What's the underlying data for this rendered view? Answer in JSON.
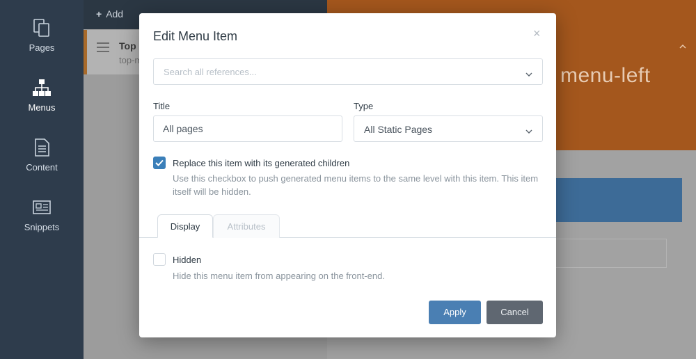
{
  "sidebar": {
    "items": [
      {
        "label": "Pages",
        "icon": "pages-icon"
      },
      {
        "label": "Menus",
        "icon": "sitemap-icon"
      },
      {
        "label": "Content",
        "icon": "document-icon"
      },
      {
        "label": "Snippets",
        "icon": "newspaper-icon"
      }
    ]
  },
  "background": {
    "add_label": "Add",
    "menu_row": {
      "title": "Top m",
      "code": "top-m"
    },
    "heading": "menu-left"
  },
  "modal": {
    "title": "Edit Menu Item",
    "close_glyph": "×",
    "reference": {
      "placeholder": "Search all references..."
    },
    "title_field": {
      "label": "Title",
      "value": "All pages"
    },
    "type_field": {
      "label": "Type",
      "value": "All Static Pages"
    },
    "replace_checkbox": {
      "label": "Replace this item with its generated children",
      "checked": true,
      "help": "Use this checkbox to push generated menu items to the same level with this item. This item itself will be hidden."
    },
    "tabs": [
      {
        "label": "Display",
        "active": true
      },
      {
        "label": "Attributes",
        "active": false
      }
    ],
    "hidden_checkbox": {
      "label": "Hidden",
      "checked": false,
      "help": "Hide this menu item from appearing on the front-end."
    },
    "buttons": {
      "apply": "Apply",
      "cancel": "Cancel"
    }
  },
  "colors": {
    "sidebar": "#2e3c4c",
    "accent_orange": "#a4571d",
    "primary_blue": "#4a7fb3",
    "checkbox_blue": "#3b7fb9"
  }
}
